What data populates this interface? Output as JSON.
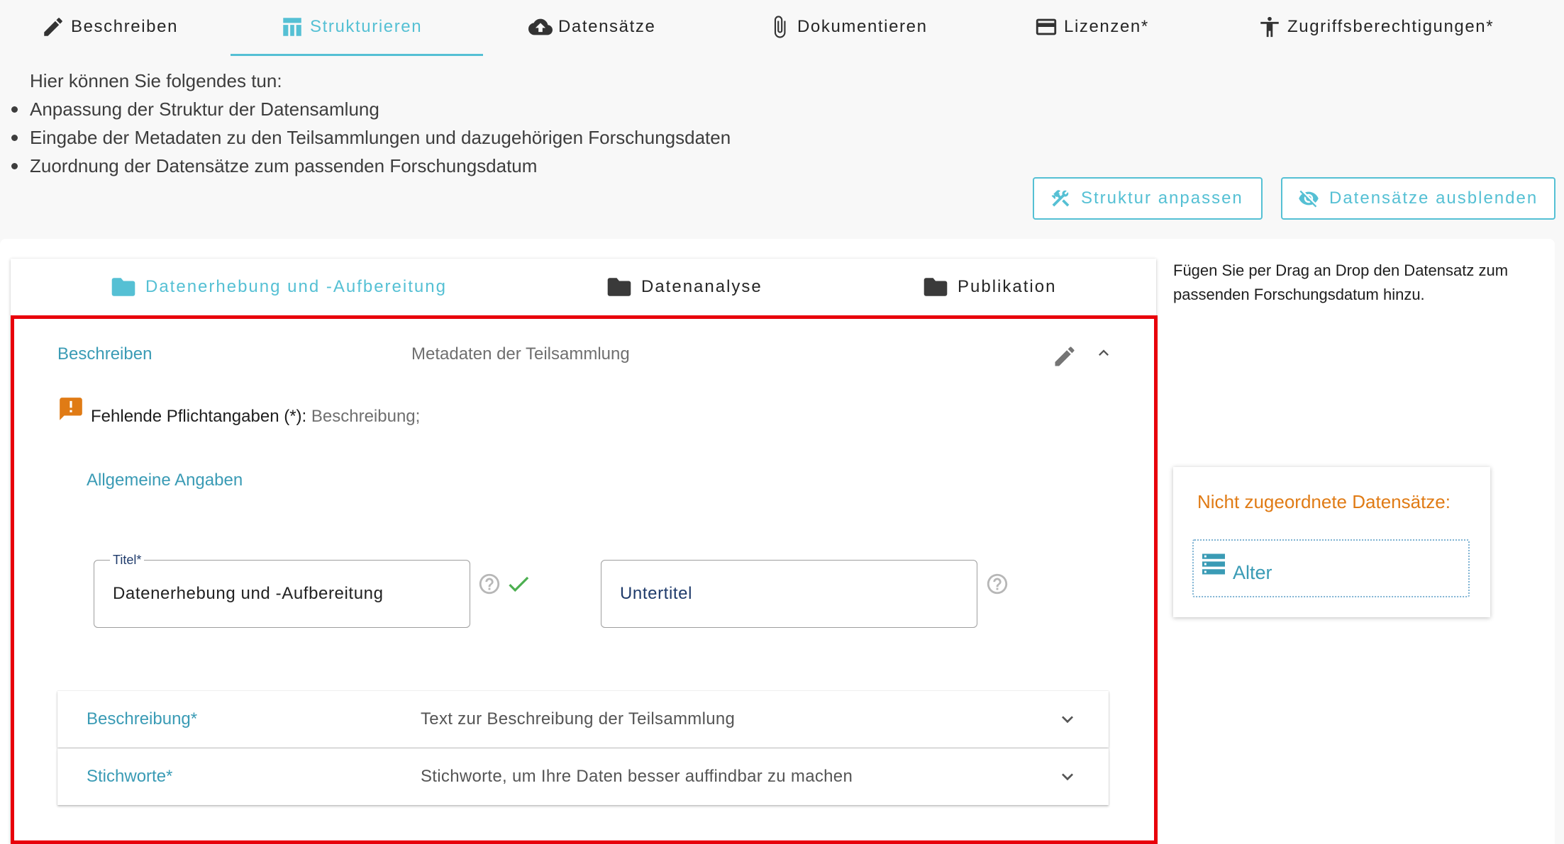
{
  "top_tabs": [
    {
      "label": "Beschreiben",
      "icon": "pencil-icon"
    },
    {
      "label": "Strukturieren",
      "icon": "table-icon",
      "active": true
    },
    {
      "label": "Datensätze",
      "icon": "cloud-upload-icon"
    },
    {
      "label": "Dokumentieren",
      "icon": "paperclip-icon"
    },
    {
      "label": "Lizenzen*",
      "icon": "card-icon"
    },
    {
      "label": "Zugriffsberechtigungen*",
      "icon": "accessibility-icon"
    }
  ],
  "intro": {
    "heading": "Hier können Sie folgendes tun:",
    "items": [
      "Anpassung der Struktur der Datensamlung",
      "Eingabe der Metadaten zu den Teilsammlungen und dazugehörigen Forschungsdaten",
      "Zuordnung der Datensätze zum passenden Forschungsdatum"
    ]
  },
  "actions": {
    "adjust_structure": "Struktur anpassen",
    "hide_datasets": "Datensätze ausblenden"
  },
  "folder_tabs": [
    {
      "label": "Datenerhebung und -Aufbereitung",
      "active": true
    },
    {
      "label": "Datenanalyse"
    },
    {
      "label": "Publikation"
    }
  ],
  "panel": {
    "label": "Beschreiben",
    "description": "Metadaten der Teilsammlung",
    "warning_label": "Fehlende Pflichtangaben (*):",
    "warning_value": "Beschreibung;",
    "section_link": "Allgemeine Angaben",
    "title_field": {
      "legend": "Titel*",
      "value": "Datenerhebung und -Aufbereitung"
    },
    "subtitle_field": {
      "placeholder": "Untertitel"
    },
    "expansions": [
      {
        "label": "Beschreibung*",
        "description": "Text zur Beschreibung der Teilsammlung"
      },
      {
        "label": "Stichworte*",
        "description": "Stichworte, um Ihre Daten besser auffindbar zu machen"
      }
    ]
  },
  "sidebar": {
    "hint": "Fügen Sie per Drag an Drop den Datensatz zum passenden Forschungsdatum hinzu.",
    "unassigned_title": "Nicht zugeordnete Datensätze:",
    "datasets": [
      {
        "label": "Alter"
      }
    ]
  },
  "colors": {
    "accent": "#55c0d4",
    "link": "#3a9bb5",
    "warning": "#e07b15",
    "highlight": "#e8000b",
    "success": "#4caf50"
  }
}
